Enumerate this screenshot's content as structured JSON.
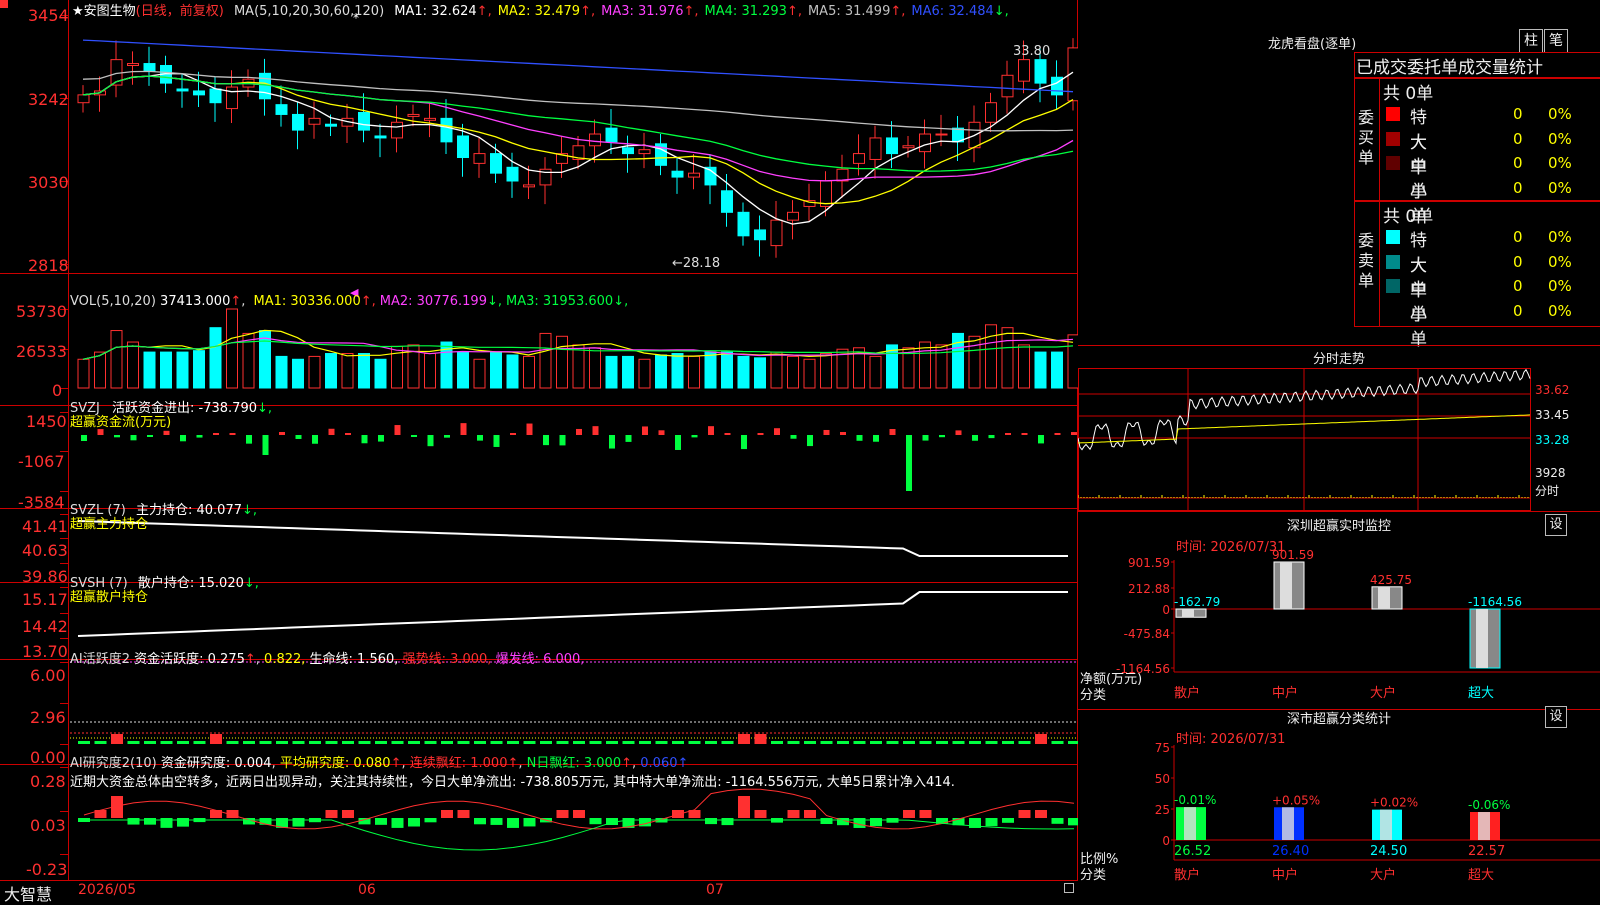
{
  "main_chart": {
    "title": "安图生物",
    "star": "★",
    "mode": "(日线，前复权)",
    "ma_label": "MA(5,10,20,30,60,120)",
    "ma_values": [
      {
        "label": "MA1: 32.624",
        "arrow": "↑",
        "color": "#ffffff",
        "arrow_color": "#ff3030"
      },
      {
        "label": "MA2: 32.479",
        "arrow": "↑",
        "color": "#ffff00",
        "arrow_color": "#ff3030"
      },
      {
        "label": "MA3: 31.976",
        "arrow": "↑",
        "color": "#ff40ff",
        "arrow_color": "#ff3030"
      },
      {
        "label": "MA4: 31.293",
        "arrow": "↑",
        "color": "#00ff40",
        "arrow_color": "#ff3030"
      },
      {
        "label": "MA5: 31.499",
        "arrow": "↑",
        "color": "#c0c0c0",
        "arrow_color": "#ff3030"
      },
      {
        "label": "MA6: 32.484",
        "arrow": "↓",
        "color": "#3050ff",
        "arrow_color": "#00ff40"
      }
    ],
    "y_ticks": [
      "3454",
      "3242",
      "3030",
      "2818"
    ],
    "high_label": "33.80",
    "low_label": "←28.18"
  },
  "volume": {
    "title": "VOL(5,10,20)",
    "value": "37413.000",
    "ma": [
      {
        "label": "MA1: 30336.000",
        "arrow": "↑",
        "color": "#ffff00",
        "arrow_color": "#ff3030"
      },
      {
        "label": "MA2: 30776.199",
        "arrow": "↓",
        "color": "#ff40ff",
        "arrow_color": "#00ff40"
      },
      {
        "label": "MA3: 31953.600",
        "arrow": "↓",
        "color": "#00ff40",
        "arrow_color": "#00ff40"
      }
    ],
    "y_ticks": [
      "53730",
      "26533",
      "0"
    ]
  },
  "svzj": {
    "title": "SVZJ",
    "label": "活跃资金进出: -738.790",
    "arrow": "↓,",
    "subtitle": "超赢资金流(万元)",
    "y_ticks": [
      "1450",
      "-1067",
      "-3584"
    ]
  },
  "svzl": {
    "title": "SVZL (7)",
    "label": "主力持仓: 40.077",
    "arrow": "↓,",
    "subtitle": "超赢主力持仓",
    "y_ticks": [
      "41.41",
      "40.63",
      "39.86"
    ]
  },
  "svsh": {
    "title": "SVSH (7)",
    "label": "散户持仓: 15.020",
    "arrow": "↓,",
    "subtitle": "超赢散户持仓",
    "y_ticks": [
      "15.17",
      "14.42",
      "13.70"
    ]
  },
  "ai_activity": {
    "title": "AI活跃度2",
    "label": "资金活跃度: 0.275",
    "v2": "0.822,",
    "life": "生命线: 1.560,",
    "strong": "强势线: 3.000,",
    "burst": "爆发线: 6.000,",
    "y_ticks": [
      "6.00",
      "2.96",
      "0.00"
    ]
  },
  "ai_research": {
    "title": "AI研究度2(10)",
    "label": "资金研究度: 0.004",
    "avg": "平均研究度: 0.080",
    "streak": "连续飘红: 1.000",
    "nday": "N日飘红: 3.000",
    "last": "0.060",
    "note": "近期大资金总体由空转多，近两日出现异动，关注其持续性，今日大单净流出: -738.805万元, 其中特大单净流出: -1164.556万元, 大单5日累计净入414.",
    "y_ticks": [
      "0.28",
      "0.03",
      "-0.23"
    ]
  },
  "bottom_bar": {
    "brand": "大智慧",
    "dates": [
      "2026/05",
      "06",
      "07"
    ]
  },
  "dragon_tiger": {
    "title": "龙虎看盘(逐单)",
    "btn_bar": "柱",
    "btn_pen": "笔",
    "tabs": [
      "已成交",
      "委托单",
      "成交量",
      "统计"
    ],
    "buy_label": [
      "委",
      "买",
      "单"
    ],
    "sell_label": [
      "委",
      "卖",
      "单"
    ],
    "buy_total": "共 0单",
    "sell_total": "共 0单",
    "buy_rows": [
      {
        "label": "特大",
        "count": "0",
        "pct": "0%",
        "color": "#ff0000"
      },
      {
        "label": "大单",
        "count": "0",
        "pct": "0%",
        "color": "#a00000"
      },
      {
        "label": "中单",
        "count": "0",
        "pct": "0%",
        "color": "#600000"
      },
      {
        "label": "小单",
        "count": "0",
        "pct": "0%",
        "color": "#000000"
      }
    ],
    "sell_rows": [
      {
        "label": "特大",
        "count": "0",
        "pct": "0%",
        "color": "#00ffff"
      },
      {
        "label": "大单",
        "count": "0",
        "pct": "0%",
        "color": "#008b8b"
      },
      {
        "label": "中单",
        "count": "0",
        "pct": "0%",
        "color": "#006666"
      },
      {
        "label": "小单",
        "count": "0",
        "pct": "0%",
        "color": "#000000"
      }
    ]
  },
  "intraday": {
    "title": "分时走势",
    "y_ticks": [
      "33.62",
      "33.45",
      "33.28",
      "3928"
    ],
    "unit": "分时"
  },
  "sz_monitor": {
    "title": "深圳超赢实时监控",
    "gear": "设",
    "time": "时间: 2026/07/31",
    "y_ticks": [
      "901.59",
      "212.88",
      "0",
      "-475.84",
      "-1164.56"
    ],
    "axis_label": "净额(万元)",
    "cat_label": "分类",
    "categories": [
      "散户",
      "中户",
      "大户",
      "超大"
    ],
    "values": [
      -162.79,
      901.59,
      425.75,
      -1164.56
    ],
    "value_labels": [
      "-162.79",
      "901.59",
      "425.75",
      "-1164.56"
    ]
  },
  "sz_class": {
    "title": "深市超赢分类统计",
    "gear": "设",
    "time": "时间: 2026/07/31",
    "y_ticks": [
      "75",
      "50",
      "25",
      "0"
    ],
    "axis_label": "比例%",
    "cat_label": "分类",
    "categories": [
      "散户",
      "中户",
      "大户",
      "超大"
    ],
    "values": [
      26.52,
      26.4,
      24.5,
      22.57
    ],
    "value_labels": [
      "26.52",
      "26.40",
      "24.50",
      "22.57"
    ],
    "changes": [
      "-0.01%",
      "+0.05%",
      "+0.02%",
      "-0.06%"
    ],
    "colors": [
      "#00ff40",
      "#0030ff",
      "#00ffff",
      "#ff2020"
    ]
  },
  "colors": {
    "up": "#ff3030",
    "down": "#00ffff",
    "frame": "#cc0000",
    "title_red": "#ff3030",
    "axis_text": "#ff3030"
  }
}
